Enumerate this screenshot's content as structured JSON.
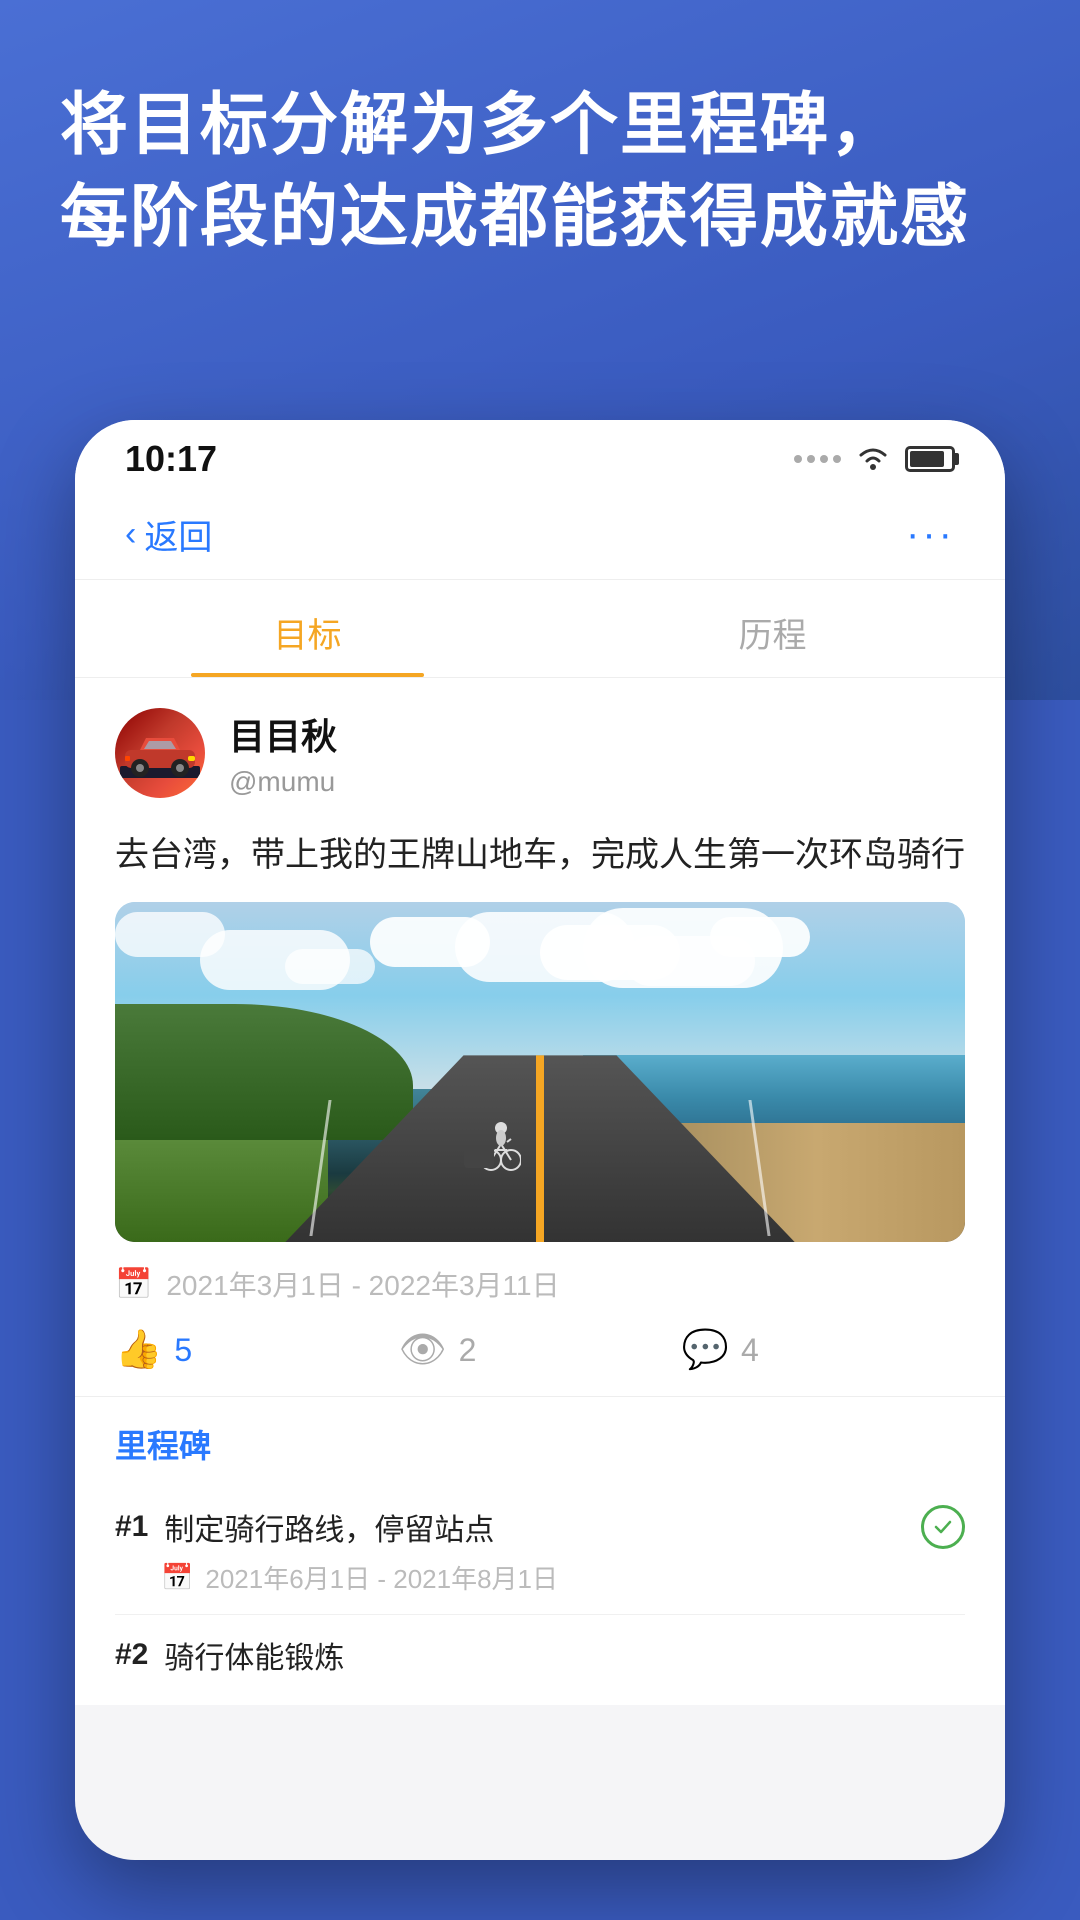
{
  "background": {
    "color": "#3a5bbf"
  },
  "hero": {
    "title": "将目标分解为多个里程碑，\n每阶段的达成都能获得成就感"
  },
  "statusBar": {
    "time": "10:17",
    "wifi": true,
    "battery": 85
  },
  "navBar": {
    "backLabel": "返回",
    "moreLabel": "···"
  },
  "tabs": [
    {
      "id": "goal",
      "label": "目标",
      "active": true
    },
    {
      "id": "history",
      "label": "历程",
      "active": false
    }
  ],
  "post": {
    "userName": "目目秋",
    "userHandle": "@mumu",
    "goalText": "去台湾，带上我的王牌山地车，完成人生第一次环岛骑行",
    "dateRange": "2021年3月1日 - 2022年3月11日",
    "stats": {
      "likes": "5",
      "views": "2",
      "comments": "4"
    }
  },
  "milestones": {
    "sectionTitle": "里程碑",
    "items": [
      {
        "num": "#1",
        "name": "制定骑行路线，停留站点",
        "dateRange": "2021年6月1日 - 2021年8月1日",
        "completed": true
      },
      {
        "num": "#2",
        "name": "骑行体能锻炼",
        "dateRange": "",
        "completed": false
      }
    ]
  }
}
